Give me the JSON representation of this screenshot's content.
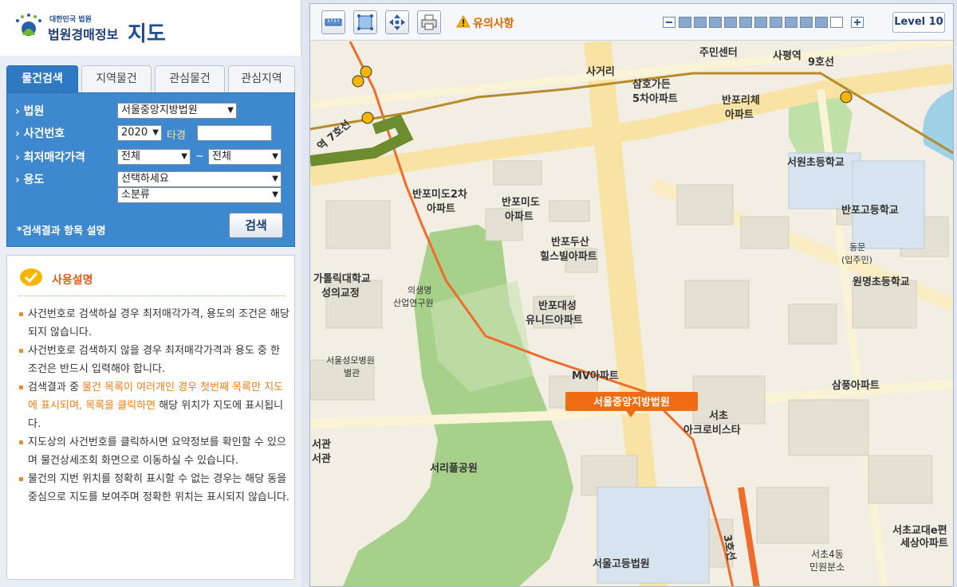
{
  "logo": {
    "small": "대한민국 법원",
    "main": "법원경매정보",
    "big": "지도"
  },
  "tabs": [
    {
      "label": "물건검색",
      "active": true
    },
    {
      "label": "지역물건",
      "active": false
    },
    {
      "label": "관심물건",
      "active": false
    },
    {
      "label": "관심지역",
      "active": false
    }
  ],
  "search": {
    "court_label": "› 법원",
    "court_value": "서울중앙지방법원",
    "case_label": "› 사건번호",
    "year_value": "2020",
    "case_type": "타경",
    "case_number": "",
    "price_label": "› 최저매각가격",
    "price_from": "전체",
    "tilde": "~",
    "price_to": "전체",
    "usage_label": "› 용도",
    "usage_major": "선택하세요",
    "usage_minor": "소분류",
    "help_link": "*검색결과 항목 설명",
    "search_button": "검색"
  },
  "guide": {
    "title": "사용설명",
    "items": [
      "사건번호로 검색하실 경우 최저매각가격, 용도의 조건은 해당되지 않습니다.",
      "사건번호로 검색하지 않을 경우 최저매각가격과 용도 중 한 조건은 반드시 입력해야 합니다.",
      "",
      "지도상의 사건번호를 클릭하시면 요약정보를 확인할 수 있으며 물건상세조회 화면으로 이동하실 수 있습니다.",
      "물건의 지번 위치를 정확히 표시할 수 없는 경우는 해당 동을 중심으로 지도를 보여주며 정확한 위치는 표시되지 않습니다."
    ],
    "item3_pre": "검색결과 중 ",
    "item3_highlight": "물건 목록이 여러개인 경우 첫번째 목록만 지도에 표시되며, 목록을 클릭하면",
    "item3_post": " 해당 위치가 지도에 표시됩니다."
  },
  "toolbar": {
    "warning": "유의사항",
    "level": "Level 10"
  },
  "zoom": {
    "filled": 10,
    "total": 12
  },
  "map": {
    "marker": "서울중앙지방법원",
    "labels": {
      "l1": "사거리",
      "l2": "주민센터",
      "l3": "사평역",
      "l4": "9호선",
      "l5": "삼호가든",
      "l6": "5차아파트",
      "l7": "반포리체",
      "l8": "아파트",
      "l9": "서원초등학교",
      "l10": "반포미도2차",
      "l11": "아파트",
      "l12": "반포미도",
      "l13": "아파트",
      "l14": "반포고등학교",
      "l15": "반포두산",
      "l16": "힐스빌아파트",
      "l17": "동문",
      "l18": "(입주민)",
      "l19": "원명초등학교",
      "l20": "가톨릭대학교",
      "l21": "성의교정",
      "l22": "의생명",
      "l23": "산업연구원",
      "l24": "반포대성",
      "l25": "유니드아파트",
      "l26": "서울성모병원",
      "l27": "별관",
      "l28": "MV아파트",
      "l29": "삼풍아파트",
      "l30": "서초",
      "l31": "아크로비스타",
      "l32": "서관",
      "l33": "서관",
      "l34": "서리풀공원",
      "l35": "서초교대e편",
      "l36": "세상아파트",
      "l37": "서초4동",
      "l38": "민원분소",
      "l39": "서울고등법원",
      "l40": "3호선",
      "l41": "역 7호선"
    }
  }
}
